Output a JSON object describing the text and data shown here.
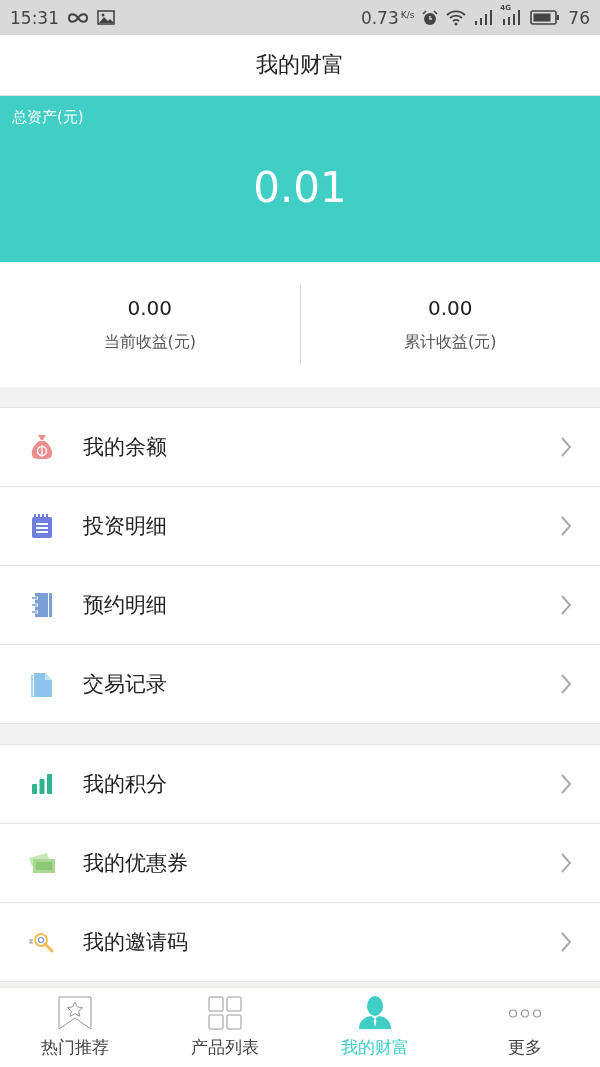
{
  "status_bar": {
    "time": "15:31",
    "speed": "0.73",
    "speed_unit": "K/s",
    "network": "4G",
    "battery": "76"
  },
  "header": {
    "title": "我的财富"
  },
  "assets": {
    "label": "总资产(元)",
    "value": "0.01"
  },
  "stats": [
    {
      "value": "0.00",
      "label": "当前收益(元)"
    },
    {
      "value": "0.00",
      "label": "累计收益(元)"
    }
  ],
  "menu_groups": [
    [
      {
        "kind": "money",
        "label": "我的余额"
      },
      {
        "kind": "notepad",
        "label": "投资明细"
      },
      {
        "kind": "notebook",
        "label": "预约明细"
      },
      {
        "kind": "document",
        "label": "交易记录"
      }
    ],
    [
      {
        "kind": "chart",
        "label": "我的积分"
      },
      {
        "kind": "cash",
        "label": "我的优惠券"
      },
      {
        "kind": "code",
        "label": "我的邀请码"
      }
    ]
  ],
  "tabs": [
    {
      "kind": "recommend",
      "label": "热门推荐",
      "selected": false
    },
    {
      "kind": "grid",
      "label": "产品列表",
      "selected": false
    },
    {
      "kind": "person",
      "label": "我的财富",
      "selected": true
    },
    {
      "kind": "more",
      "label": "更多",
      "selected": false
    }
  ]
}
